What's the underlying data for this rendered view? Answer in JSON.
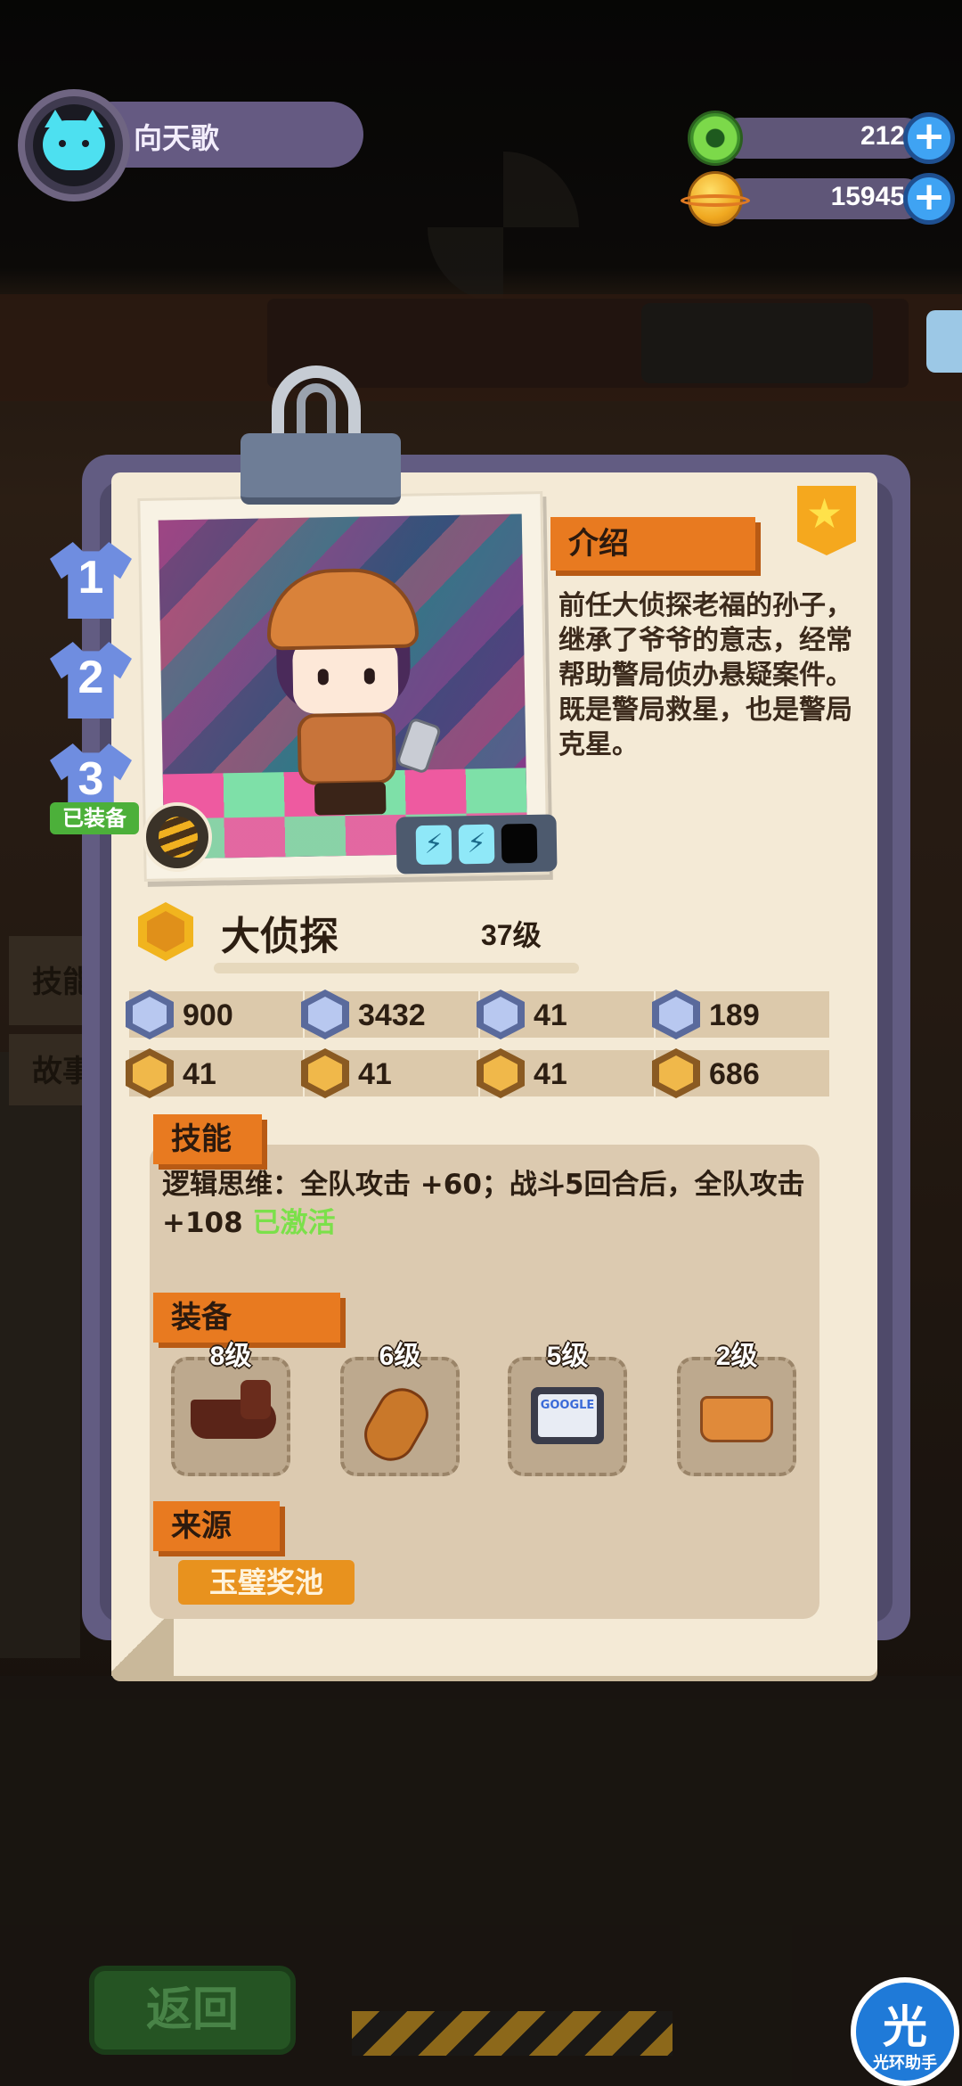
{
  "player": {
    "name": "向天歌"
  },
  "currency": {
    "gems": {
      "value": "212",
      "icon": "green-donut-coin-icon",
      "add_icon": "plus-icon"
    },
    "coins": {
      "value": "15945",
      "icon": "planet-coin-icon",
      "add_icon": "plus-icon"
    }
  },
  "outfits": [
    {
      "label": "1"
    },
    {
      "label": "2"
    },
    {
      "label": "3"
    }
  ],
  "outfit_equipped_label": "已装备",
  "character": {
    "name": "大侦探",
    "level": "37级",
    "energy": {
      "filled": 2,
      "total": 3
    }
  },
  "intro": {
    "title": "介绍",
    "text": "前任大侦探老福的孙子，继承了爷爷的意志，经常帮助警局侦办悬疑案件。既是警局救星，也是警局克星。"
  },
  "stats": [
    {
      "icon": "heart-shield-icon",
      "value": "900"
    },
    {
      "icon": "rocket-icon",
      "value": "3432"
    },
    {
      "icon": "shield-icon",
      "value": "41"
    },
    {
      "icon": "anchor-icon",
      "value": "189"
    },
    {
      "icon": "fist-icon",
      "value": "41"
    },
    {
      "icon": "smile-icon",
      "value": "41"
    },
    {
      "icon": "muscle-icon",
      "value": "41"
    },
    {
      "icon": "brain-icon",
      "value": "686"
    }
  ],
  "skill": {
    "title": "技能",
    "text": "逻辑思维：全队攻击 +60；战斗5回合后，全队攻击 +108",
    "status": "已激活"
  },
  "equipment": {
    "title": "装备",
    "items": [
      {
        "icon": "pipe-icon",
        "level": "8级"
      },
      {
        "icon": "violin-icon",
        "level": "6级"
      },
      {
        "icon": "tablet-icon",
        "level": "5级",
        "screen_text": "GOOGLE"
      },
      {
        "icon": "shorts-icon",
        "level": "2级"
      }
    ]
  },
  "source": {
    "title": "来源",
    "button": "玉璧奖池"
  },
  "background": {
    "side_tabs": [
      "技能",
      "故事"
    ]
  },
  "footer": {
    "back_button": "返回"
  },
  "watermark": {
    "big": "光",
    "small": "光环助手"
  },
  "colors": {
    "accent_orange": "#e87a20",
    "card_paper": "#f4ead6",
    "skill_active": "#7be04a",
    "frame_purple": "#625c82"
  }
}
